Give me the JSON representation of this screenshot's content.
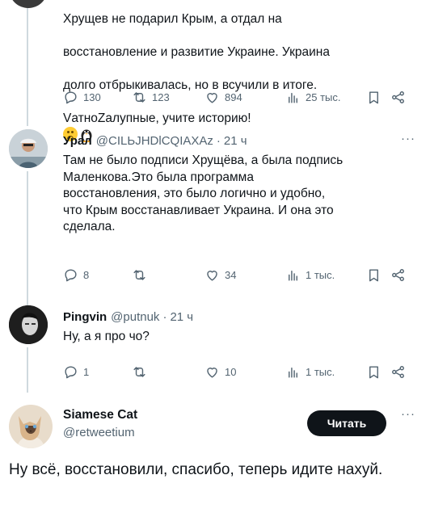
{
  "tweets": [
    {
      "text_lines": [
        "Хрущев не подарил Крым, а отдал на",
        "восстановление и развитие Украине. Украина",
        "долго отбрыкивалась, но в всучили в итоге.",
        "VатноZалупные, учите историю!"
      ],
      "stats": {
        "replies": "130",
        "retweets": "123",
        "likes": "894",
        "views": "25 тыс."
      }
    },
    {
      "name": "Урал",
      "handle": "@CILЬJHDlCQIAXAz",
      "time": "21 ч",
      "text": "Там не было подписи Хрущёва, а была подпись\nМаленкова.Это была программа\nвосстановления, это было логично и удобно,\nчто Крым восстанавливает Украина. И она это\nсделала.",
      "stats": {
        "replies": "8",
        "retweets": "",
        "likes": "34",
        "views": "1 тыс."
      }
    },
    {
      "name": "Pingvin",
      "handle": "@putnuk",
      "time": "21 ч",
      "text": "Ну, а я про чо?",
      "stats": {
        "replies": "1",
        "retweets": "",
        "likes": "10",
        "views": "1 тыс."
      }
    }
  ],
  "main": {
    "name": "Siamese Cat",
    "handle": "@retweetium",
    "follow_label": "Читать",
    "text": "Ну всё, восстановили, спасибо, теперь идите нахуй."
  },
  "icons": {
    "more": "more-icon",
    "reply": "reply-icon",
    "retweet": "retweet-icon",
    "like": "heart-icon",
    "views": "views-icon",
    "bookmark": "bookmark-icon",
    "share": "share-icon"
  },
  "colors": {
    "text": "#0f1419",
    "secondary": "#536471",
    "button": "#0f1419",
    "line": "#cfd9de"
  }
}
